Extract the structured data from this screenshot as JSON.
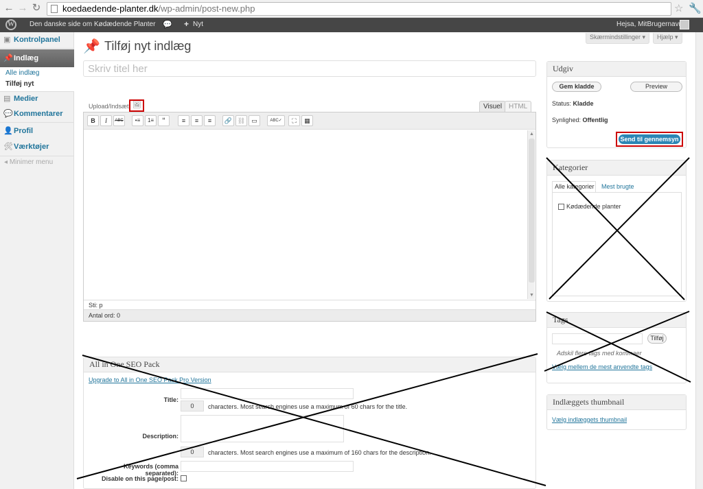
{
  "browser": {
    "domain": "koedaedende-planter.dk",
    "path": "/wp-admin/post-new.php",
    "back_icon": "arrow-left",
    "forward_icon": "arrow-right",
    "reload_icon": "reload",
    "star_icon": "star",
    "wrench_icon": "wrench"
  },
  "adminbar": {
    "site_name": "Den danske side om Kødædende Planter",
    "comments_icon": "speech-bubble",
    "new_label": "Nyt",
    "greeting": "Hejsa, MitBrugernavn"
  },
  "menu": {
    "dashboard": "Kontrolpanel",
    "posts": "Indlæg",
    "posts_sub": [
      "Alle indlæg",
      "Tilføj nyt"
    ],
    "media": "Medier",
    "comments": "Kommentarer",
    "profile": "Profil",
    "tools": "Værktøjer",
    "collapse": "Minimer menu"
  },
  "header": {
    "screen_options": "Skærmindstillinger",
    "help": "Hjælp",
    "page_title": "Tilføj nyt indlæg",
    "title_placeholder": "Skriv titel her"
  },
  "editor": {
    "upload_label": "Upload/Indsæt",
    "tab_visual": "Visuel",
    "tab_html": "HTML",
    "toolbar": [
      "B",
      "I",
      "ABC",
      "•≡",
      "1≡",
      "“",
      "≡",
      "≡",
      "≡",
      "🔗",
      "⛓",
      "▭",
      "ABC✓",
      "⛶",
      "▦"
    ],
    "path_label": "Sti: p",
    "word_count": "Antal ord: 0"
  },
  "seo": {
    "title": "All in One SEO Pack",
    "upgrade_link": "Upgrade to All in One SEO Pack Pro Version",
    "title_label": "Title:",
    "title_count": "0",
    "title_note": "characters. Most search engines use a maximum of 60 chars for the title.",
    "description_label": "Description:",
    "description_count": "0",
    "description_note": "characters. Most search engines use a maximum of 160 chars for the description.",
    "keywords_label": "Keywords (comma separated):",
    "disable_label": "Disable on this page/post:"
  },
  "publish": {
    "title": "Udgiv",
    "save_draft": "Gem kladde",
    "preview": "Preview",
    "status_label": "Status:",
    "status_value": "Kladde",
    "visibility_label": "Synlighed:",
    "visibility_value": "Offentlig",
    "submit": "Send til gennemsyn"
  },
  "categories": {
    "title": "Kategorier",
    "tab_all": "Alle kategorier",
    "tab_popular": "Mest brugte",
    "items": [
      "Kødædende planter"
    ]
  },
  "tags": {
    "title": "Tags",
    "add_button": "Tilføj",
    "hint": "Adskil flere tags med kommaer",
    "choose_link": "Vælg mellem de mest anvendte tags"
  },
  "thumbnail": {
    "title": "Indlæggets thumbnail",
    "link": "Vælg indlæggets thumbnail"
  },
  "annotation_color": "#cc0000"
}
